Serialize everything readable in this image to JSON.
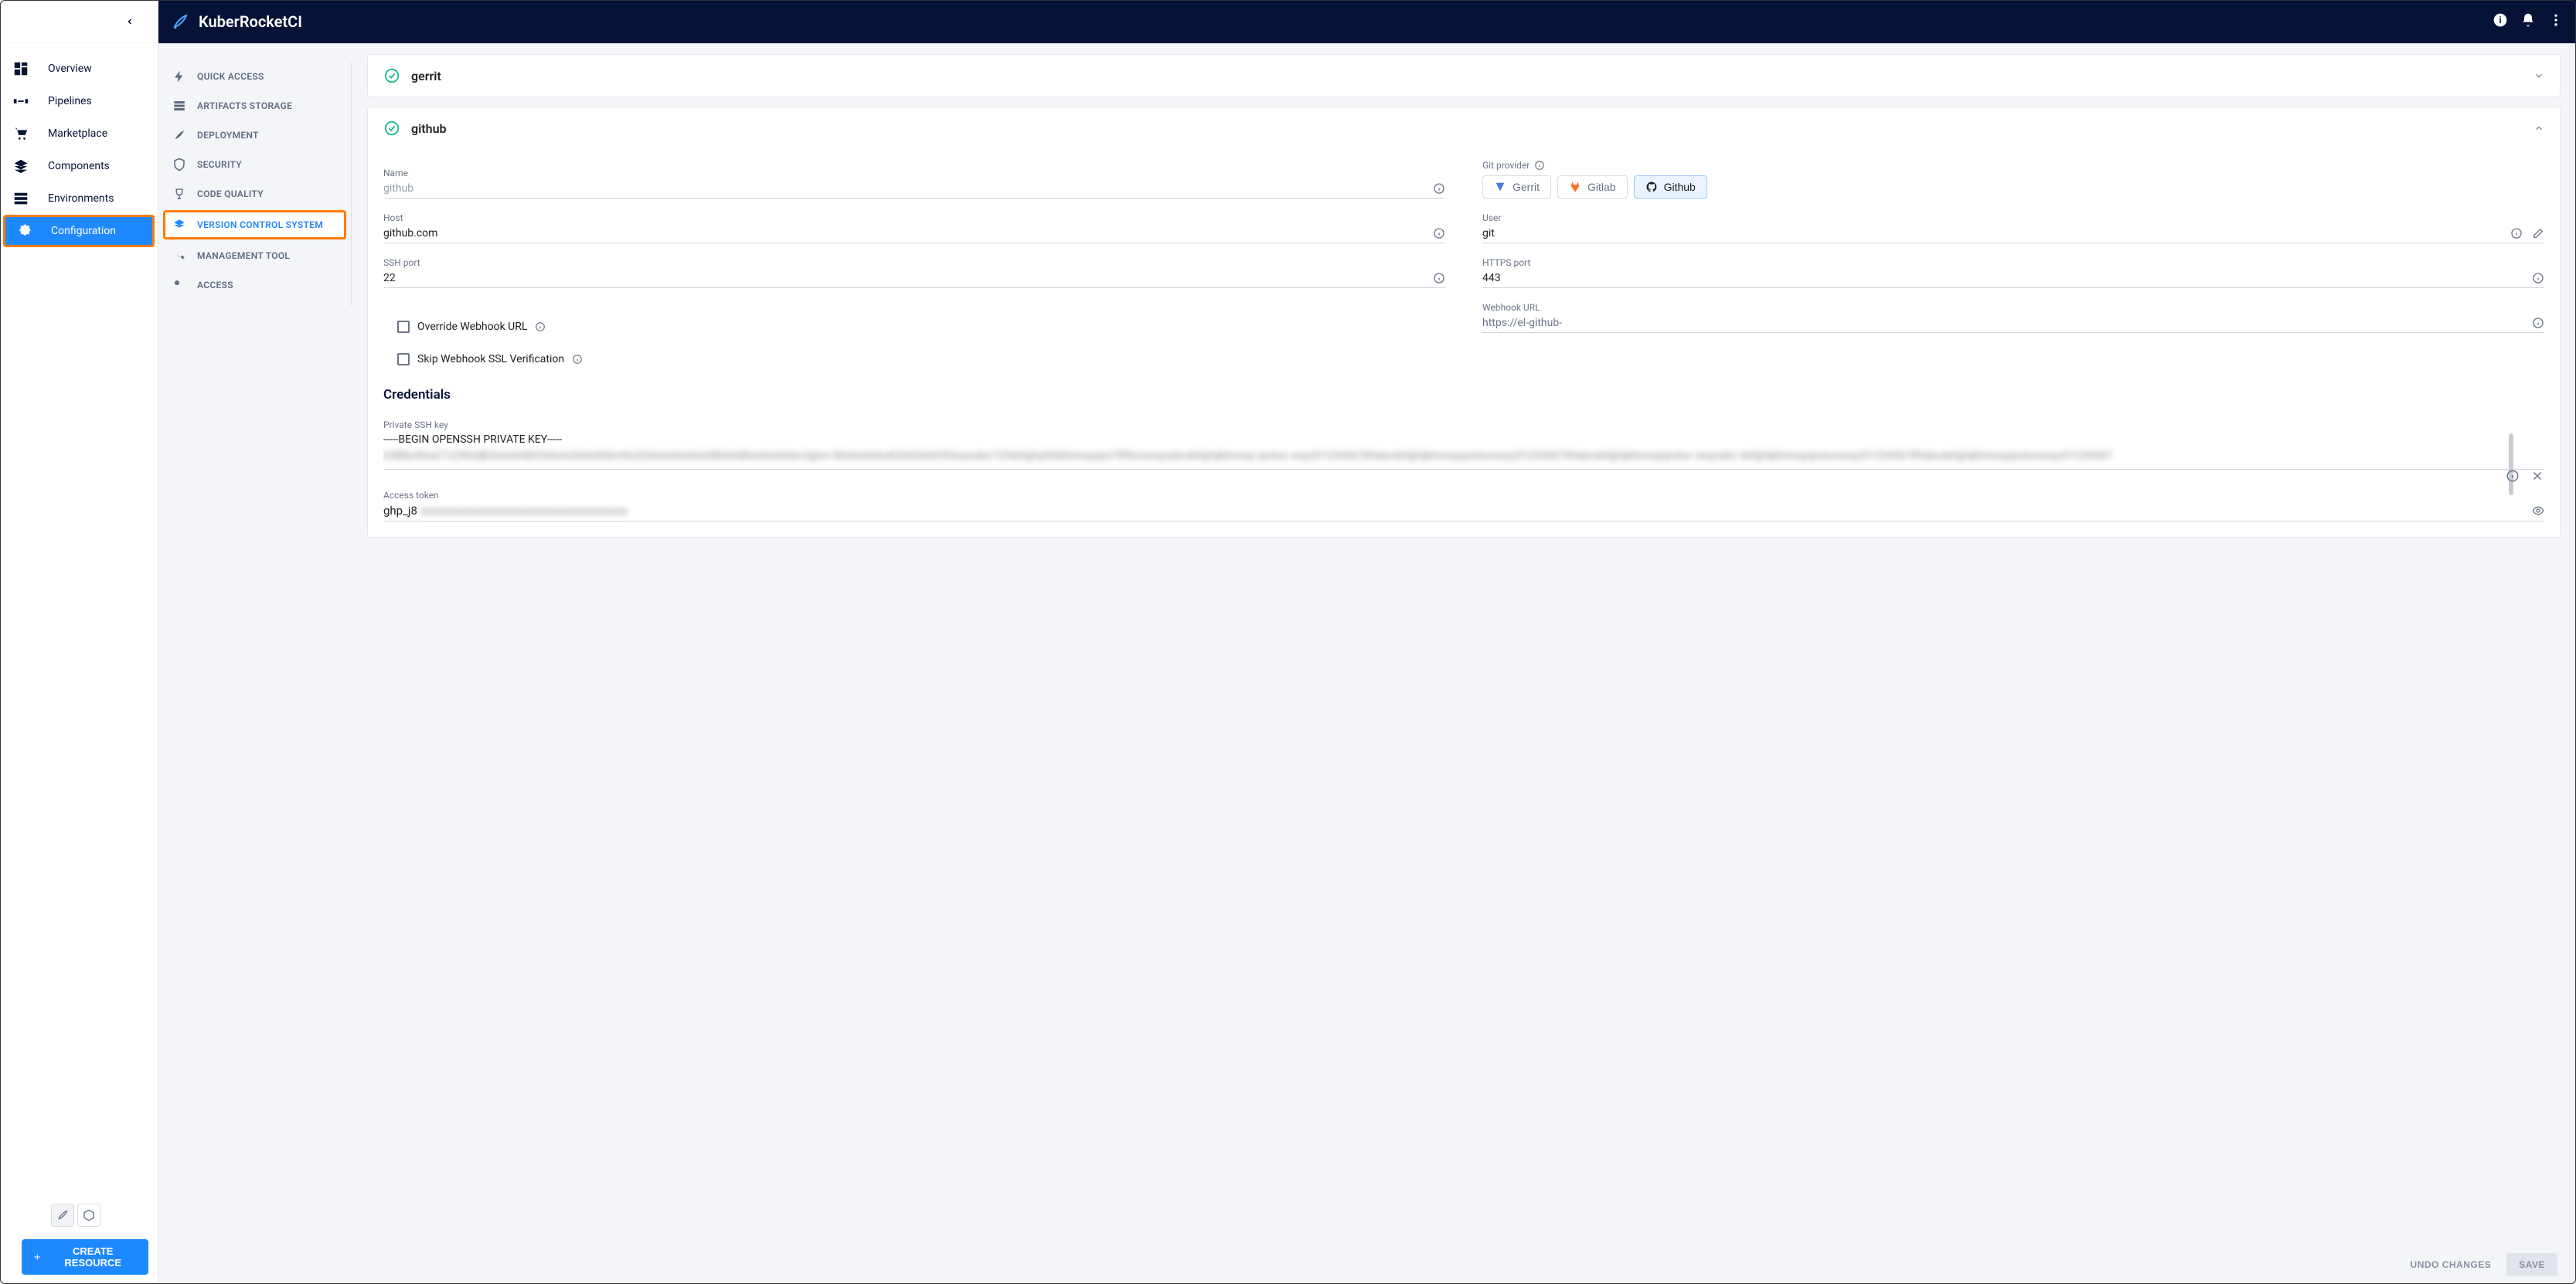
{
  "brand": "KuberRocketCI",
  "sidebar": {
    "items": [
      {
        "label": "Overview"
      },
      {
        "label": "Pipelines"
      },
      {
        "label": "Marketplace"
      },
      {
        "label": "Components"
      },
      {
        "label": "Environments"
      },
      {
        "label": "Configuration"
      }
    ],
    "create": "CREATE RESOURCE"
  },
  "sub": {
    "items": [
      {
        "label": "QUICK ACCESS"
      },
      {
        "label": "ARTIFACTS STORAGE"
      },
      {
        "label": "DEPLOYMENT"
      },
      {
        "label": "SECURITY"
      },
      {
        "label": "CODE QUALITY"
      },
      {
        "label": "VERSION CONTROL SYSTEM"
      },
      {
        "label": "MANAGEMENT TOOL"
      },
      {
        "label": "ACCESS"
      }
    ]
  },
  "gerrit": {
    "title": "gerrit"
  },
  "github": {
    "title": "github",
    "name_label": "Name",
    "name_value": "github",
    "provider_label": "Git provider",
    "providers": [
      {
        "label": "Gerrit"
      },
      {
        "label": "Gitlab"
      },
      {
        "label": "Github"
      }
    ],
    "host_label": "Host",
    "host_value": "github.com",
    "user_label": "User",
    "user_value": "git",
    "ssh_port_label": "SSH port",
    "ssh_port_value": "22",
    "https_port_label": "HTTPS port",
    "https_port_value": "443",
    "override_label": "Override Webhook URL",
    "skip_ssl_label": "Skip Webhook SSL Verification",
    "webhook_label": "Webhook URL",
    "webhook_value": "https://el-github-",
    "credentials_title": "Credentials",
    "ssh_key_label": "Private SSH key",
    "ssh_key_header": "-----BEGIN OPENSSH PRIVATE KEY-----",
    "ssh_key_blur": "b3BlbnNzaC1rZXktdjEAAAAABG5vbmUAAAAEbm9uZQAAAAAAAAABAAABlwAAAAdzc2gtcn NhAAAAAwEAAQAAAYEAxyzabc123defghij456klmnopqrs789tuvwxyzabcdefghijklmnop qrstuv wxyz0123456789abcdefghijklmnopqrstuvwxyz0123456789abcdefghijklmnopqrstuv wxyzabc defghijklmnopqrstuvwxyz0123456789abcdefghijklmnopqrstuvwxyz01234567",
    "token_label": "Access token",
    "token_prefix": "ghp_j8",
    "token_blur": "xxxxxxxxxxxxxxxxxxxxxxxxxxxxxxxxxxxx"
  },
  "actions": {
    "undo": "UNDO CHANGES",
    "save": "SAVE"
  }
}
